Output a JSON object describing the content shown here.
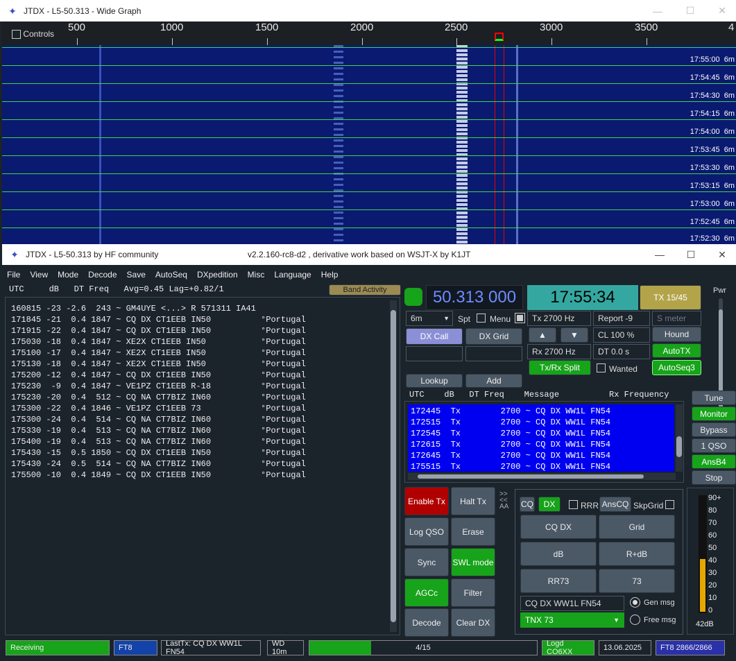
{
  "graph": {
    "title": "JTDX - L5-50.313 - Wide Graph",
    "controls_label": "Controls",
    "scale": [
      "500",
      "1000",
      "1500",
      "2000",
      "2500",
      "3000",
      "3500",
      "4"
    ],
    "times": [
      "17:55:00",
      "17:54:45",
      "17:54:30",
      "17:54:15",
      "17:54:00",
      "17:53:45",
      "17:53:30",
      "17:53:15",
      "17:53:00",
      "17:52:45",
      "17:52:30"
    ],
    "band": "6m"
  },
  "main": {
    "title": "JTDX - L5-50.313  by HF community",
    "subtitle": "v2.2.160-rc8-d2 , derivative work based on WSJT-X by K1JT"
  },
  "menu": [
    "File",
    "View",
    "Mode",
    "Decode",
    "Save",
    "AutoSeq",
    "DXpedition",
    "Misc",
    "Language",
    "Help"
  ],
  "left": {
    "header": "UTC     dB   DT Freq   Avg=0.45 Lag=+0.82/1",
    "band_activity": "Band Activity",
    "rows": [
      "160815 -23 -2.6  243 ~ GM4UYE <...> R 571311 IA41",
      "171845 -21  0.4 1847 ~ CQ DX CT1EEB IN50          °Portugal",
      "171915 -22  0.4 1847 ~ CQ DX CT1EEB IN50          °Portugal",
      "175030 -18  0.4 1847 ~ XE2X CT1EEB IN50           °Portugal",
      "175100 -17  0.4 1847 ~ XE2X CT1EEB IN50           °Portugal",
      "175130 -18  0.4 1847 ~ XE2X CT1EEB IN50           °Portugal",
      "175200 -12  0.4 1847 ~ CQ DX CT1EEB IN50          °Portugal",
      "175230  -9  0.4 1847 ~ VE1PZ CT1EEB R-18          °Portugal",
      "175230 -20  0.4  512 ~ CQ NA CT7BIZ IN60          °Portugal",
      "175300 -22  0.4 1846 ~ VE1PZ CT1EEB 73            °Portugal",
      "175300 -24  0.4  514 ~ CQ NA CT7BIZ IN60          °Portugal",
      "175330 -19  0.4  513 ~ CQ NA CT7BIZ IN60          °Portugal",
      "175400 -19  0.4  513 ~ CQ NA CT7BIZ IN60          °Portugal",
      "175430 -15  0.5 1850 ~ CQ DX CT1EEB IN50          °Portugal",
      "175430 -24  0.5  514 ~ CQ NA CT7BIZ IN60          °Portugal",
      "175500 -10  0.4 1849 ~ CQ DX CT1EEB IN50          °Portugal"
    ]
  },
  "ctrl": {
    "freq": "50.313 000",
    "clock": "17:55:34",
    "tx_period": "TX 15/45",
    "pwr": "Pwr",
    "band": "6m",
    "spt": "Spt",
    "menu": "Menu",
    "tx_hz": "Tx  2700  Hz",
    "report": "Report -9",
    "smeter": "S meter",
    "dx_call": "DX Call",
    "dx_grid": "DX Grid",
    "up": "▲",
    "down": "▼",
    "cl": "CL  100 %",
    "hound": "Hound",
    "rx_hz": "Rx  2700  Hz",
    "dt": "DT 0.0 s",
    "autotx": "AutoTX",
    "txrx": "Tx/Rx Split",
    "wanted": "Wanted",
    "autoseq3": "AutoSeq3",
    "lookup": "Lookup",
    "add": "Add"
  },
  "rx": {
    "header": "UTC    dB   DT Freq    Message          Rx Frequency",
    "rows": [
      "172445  Tx        2700 ~ CQ DX WW1L FN54",
      "172515  Tx        2700 ~ CQ DX WW1L FN54",
      "172545  Tx        2700 ~ CQ DX WW1L FN54",
      "172615  Tx        2700 ~ CQ DX WW1L FN54",
      "172645  Tx        2700 ~ CQ DX WW1L FN54",
      "175515  Tx        2700 ~ CQ DX WW1L FN54"
    ]
  },
  "side": [
    "Tune",
    "Monitor",
    "Bypass",
    "1 QSO",
    "AnsB4",
    "Stop"
  ],
  "actions": [
    "Enable Tx",
    "Halt Tx",
    "Log QSO",
    "Erase",
    "Sync",
    "SWL mode",
    "AGCc",
    "Filter",
    "Decode",
    "Clear DX"
  ],
  "seq": {
    "cq": "CQ",
    "dx": "DX",
    "rrr": "RRR",
    "anscq": "AnsCQ",
    "skpgrid": "SkpGrid",
    "b1": "CQ DX",
    "b2": "Grid",
    "b3": "dB",
    "b4": "R+dB",
    "b5": "RR73",
    "b6": "73",
    "msg": "CQ DX WW1L FN54",
    "gen": "Gen msg",
    "tnx": "TNX 73",
    "free": "Free msg"
  },
  "meter": {
    "scale": [
      "90+",
      "80",
      "70",
      "60",
      "50",
      "40",
      "30",
      "20",
      "10",
      "0"
    ],
    "value": "42dB",
    "level_db": 42
  },
  "statusbar": {
    "state": "Receiving",
    "mode": "FT8",
    "lasttx": "LastTx: CQ DX WW1L FN54",
    "wd": "WD 10m",
    "progress": "4/15",
    "progress_frac": 0.27,
    "logd": "Logd CO6XX",
    "date": "13.06.2025",
    "count": "FT8  2866/2866"
  }
}
